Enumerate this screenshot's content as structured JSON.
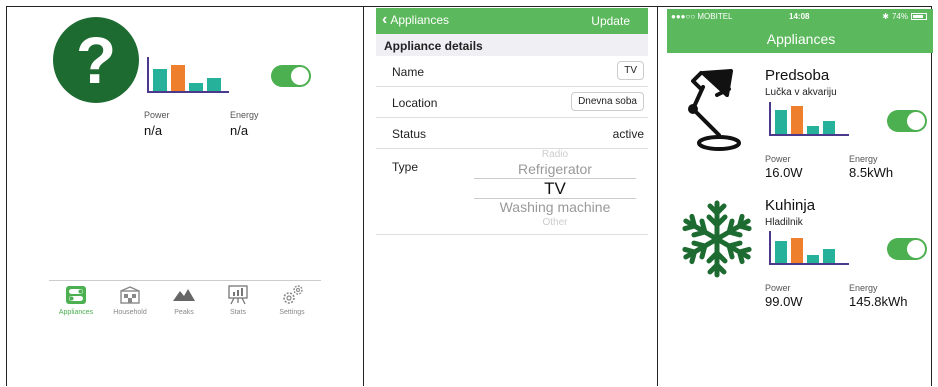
{
  "colors": {
    "green": "#5cb85c",
    "dark_green": "#1e6b32",
    "toggle_green": "#4caf50",
    "bar_teal": "#26b29a",
    "bar_orange": "#ee7f2d",
    "axis": "#4b3a8c"
  },
  "panel1": {
    "status_icon": "question-mark-icon",
    "power_label": "Power",
    "power_value": "n/a",
    "energy_label": "Energy",
    "energy_value": "n/a",
    "toggle_on": true,
    "tabs": [
      {
        "label": "Appliances",
        "icon": "toggle-switch-icon",
        "active": true
      },
      {
        "label": "Household",
        "icon": "house-icon",
        "active": false
      },
      {
        "label": "Peaks",
        "icon": "mountain-peaks-icon",
        "active": false
      },
      {
        "label": "Stats",
        "icon": "stats-easel-icon",
        "active": false
      },
      {
        "label": "Settings",
        "icon": "gears-icon",
        "active": false
      }
    ]
  },
  "panel2": {
    "back_label": "Appliances",
    "update_label": "Update",
    "section_title": "Appliance details",
    "name_label": "Name",
    "name_value": "TV",
    "location_label": "Location",
    "location_value": "Dnevna soba",
    "status_label": "Status",
    "status_value": "active",
    "type_label": "Type",
    "type_options": [
      "Radio",
      "Refrigerator",
      "TV",
      "Washing machine",
      "Other"
    ],
    "type_selected": "TV"
  },
  "panel3": {
    "status_bar": {
      "carrier": "●●●○○ MOBITEL",
      "time": "14:08",
      "battery": "74%"
    },
    "title": "Appliances",
    "cards": [
      {
        "name": "Predsoba",
        "subtitle": "Lučka v akvariju",
        "icon": "desk-lamp-icon",
        "power_label": "Power",
        "power_value": "16.0W",
        "energy_label": "Energy",
        "energy_value": "8.5kWh",
        "toggle_on": true
      },
      {
        "name": "Kuhinja",
        "subtitle": "Hladilnik",
        "icon": "snowflake-icon",
        "power_label": "Power",
        "power_value": "99.0W",
        "energy_label": "Energy",
        "energy_value": "145.8kWh",
        "toggle_on": true
      }
    ]
  }
}
